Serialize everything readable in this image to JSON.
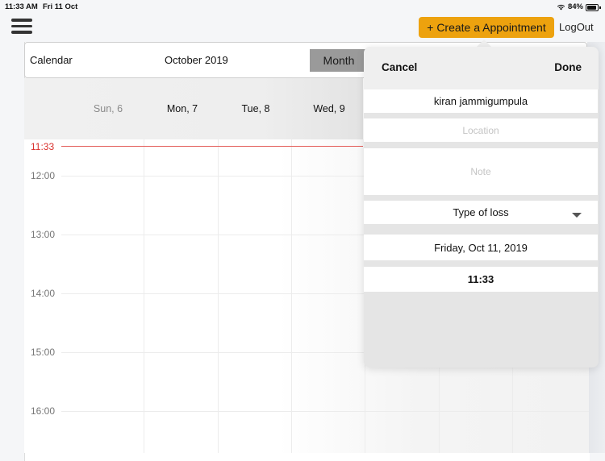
{
  "status_bar": {
    "time": "11:33 AM",
    "date": "Fri 11 Oct",
    "battery": "84%"
  },
  "toolbar": {
    "menu_icon": "hamburger-icon",
    "create_label": "+ Create a Appointment",
    "logout_label": "LogOut",
    "accent_color": "#eda20e"
  },
  "calendar": {
    "title": "Calendar",
    "month_label": "October 2019",
    "view_button": "Month",
    "days": [
      {
        "label": "Sun, 6",
        "muted": true
      },
      {
        "label": "Mon, 7",
        "muted": false
      },
      {
        "label": "Tue, 8",
        "muted": false
      },
      {
        "label": "Wed, 9",
        "muted": false
      }
    ],
    "current_time": "11:33",
    "hours": [
      "12:00",
      "13:00",
      "14:00",
      "15:00",
      "16:00"
    ],
    "now_color": "#d9302c"
  },
  "popover": {
    "cancel_label": "Cancel",
    "done_label": "Done",
    "name_value": "kiran jammigumpula",
    "location_placeholder": "Location",
    "note_placeholder": "Note",
    "type_of_loss": "Type of loss",
    "date_value": "Friday, Oct 11, 2019",
    "time_value": "11:33"
  }
}
